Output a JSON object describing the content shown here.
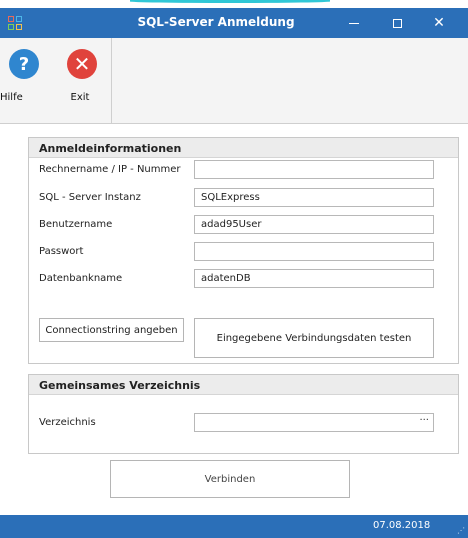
{
  "window": {
    "title": "SQL-Server Anmeldung",
    "minimize_glyph": "—",
    "maximize_glyph": "□",
    "close_glyph": "✕"
  },
  "toolbar": {
    "help_label": "Hilfe",
    "help_glyph": "?",
    "exit_label": "Exit",
    "exit_glyph": "✕"
  },
  "login": {
    "header": "Anmeldeinformationen",
    "fields": [
      {
        "label": "Rechnername / IP - Nummer",
        "value": ""
      },
      {
        "label": "SQL - Server Instanz",
        "value": "SQLExpress"
      },
      {
        "label": "Benutzername",
        "value": "adad95User"
      },
      {
        "label": "Passwort",
        "value": ""
      },
      {
        "label": "Datenbankname",
        "value": "adatenDB"
      }
    ],
    "connectionstring_button": "Connectionstring angeben",
    "test_button": "Eingegebene Verbindungsdaten testen"
  },
  "shared": {
    "header": "Gemeinsames Verzeichnis",
    "directory_label": "Verzeichnis",
    "directory_value": "",
    "browse_glyph": "···"
  },
  "connect_button": "Verbinden",
  "status": {
    "date": "07.08.2018"
  },
  "colors": {
    "titlebar": "#2b6fb8",
    "help_icon": "#2f86cf",
    "exit_icon": "#e0433c"
  }
}
